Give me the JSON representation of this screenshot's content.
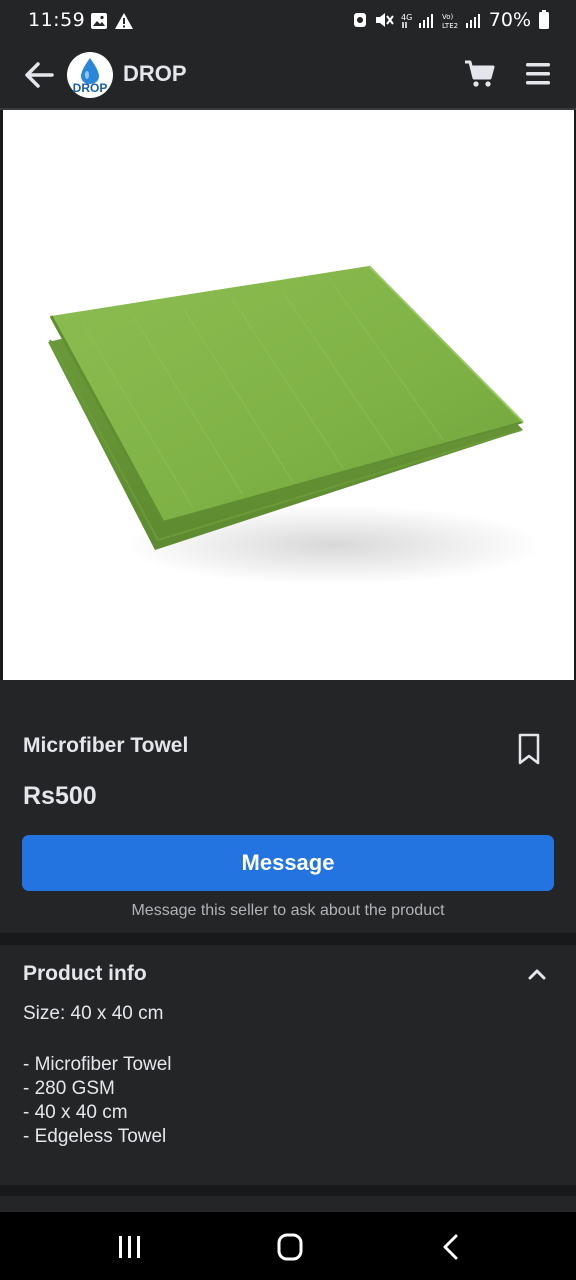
{
  "status_bar": {
    "time": "11:59",
    "battery": "70%"
  },
  "header": {
    "logo_text": "DROP",
    "title": "DROP"
  },
  "product": {
    "title": "Microfiber Towel",
    "price": "Rs500",
    "image_icon": "green-towel-image"
  },
  "actions": {
    "message_label": "Message",
    "message_hint": "Message this seller to ask about the product"
  },
  "product_info": {
    "heading": "Product info",
    "size": "Size: 40 x 40 cm",
    "bullets": [
      "- Microfiber Towel",
      "- 280 GSM",
      "- 40 x 40 cm",
      "- Edgeless Towel"
    ]
  },
  "colors": {
    "background": "#18191a",
    "surface": "#242526",
    "accent": "#2374e1",
    "text": "#e4e6eb",
    "muted_text": "#b0b3b8"
  }
}
